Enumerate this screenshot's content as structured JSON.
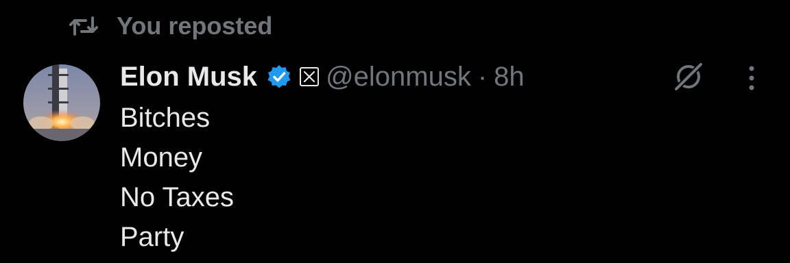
{
  "repost": {
    "icon": "repost-icon",
    "text": "You reposted"
  },
  "tweet": {
    "avatar": "avatar",
    "display_name": "Elon Musk",
    "verified_icon": "verified-badge-icon",
    "affiliate_icon": "x-logo-icon",
    "handle": "@elonmusk",
    "separator": "·",
    "time": "8h",
    "lines": [
      "Bitches",
      "Money",
      "No Taxes",
      "Party"
    ]
  },
  "actions": {
    "grok_icon": "grok-icon",
    "more_icon": "more-icon"
  },
  "colors": {
    "background": "#000000",
    "text_primary": "#e7e9ea",
    "text_secondary": "#71767b",
    "verified_blue": "#1d9bf0"
  }
}
